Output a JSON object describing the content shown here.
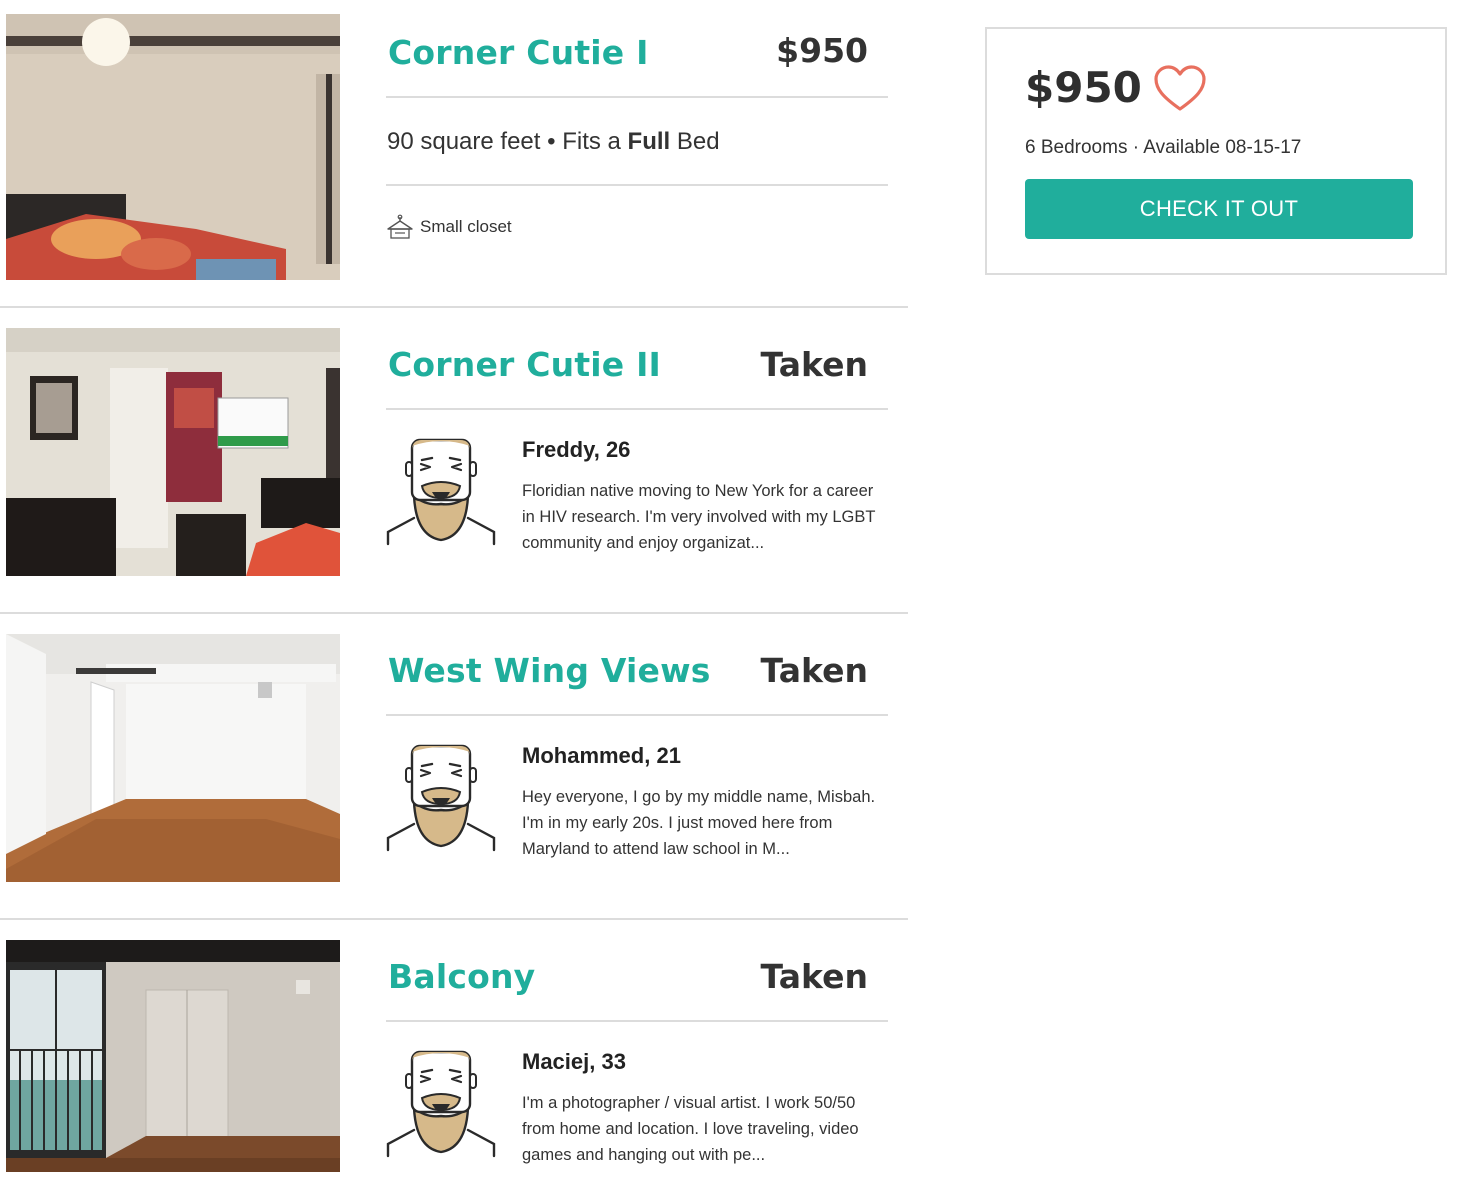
{
  "listings": [
    {
      "title": "Corner Cutie I",
      "status": "$950",
      "details": {
        "size": "90 square feet",
        "separator": " • ",
        "fits_prefix": "Fits a ",
        "bed": "Full",
        "bed_suffix": " Bed"
      },
      "amenity": "Small closet"
    },
    {
      "title": "Corner Cutie II",
      "status": "Taken",
      "occupant": {
        "name": "Freddy, 26",
        "bio": "Floridian native moving to New York for a career in HIV research. I'm very involved with my LGBT community and enjoy organizat..."
      }
    },
    {
      "title": "West Wing Views",
      "status": "Taken",
      "occupant": {
        "name": "Mohammed, 21",
        "bio": "Hey everyone, I go by my middle name, Misbah. I'm in my early 20s. I just moved here from Maryland to attend law school in M..."
      }
    },
    {
      "title": "Balcony",
      "status": "Taken",
      "occupant": {
        "name": "Maciej, 33",
        "bio": "I'm a photographer / visual artist. I work 50/50 from home and location. I love traveling, video games and hanging out with pe..."
      }
    }
  ],
  "summary": {
    "price": "$950",
    "meta": "6 Bedrooms · Available 08-15-17",
    "cta_label": "CHECK IT OUT"
  },
  "colors": {
    "accent": "#20ae9c",
    "heart": "#e8705f"
  }
}
